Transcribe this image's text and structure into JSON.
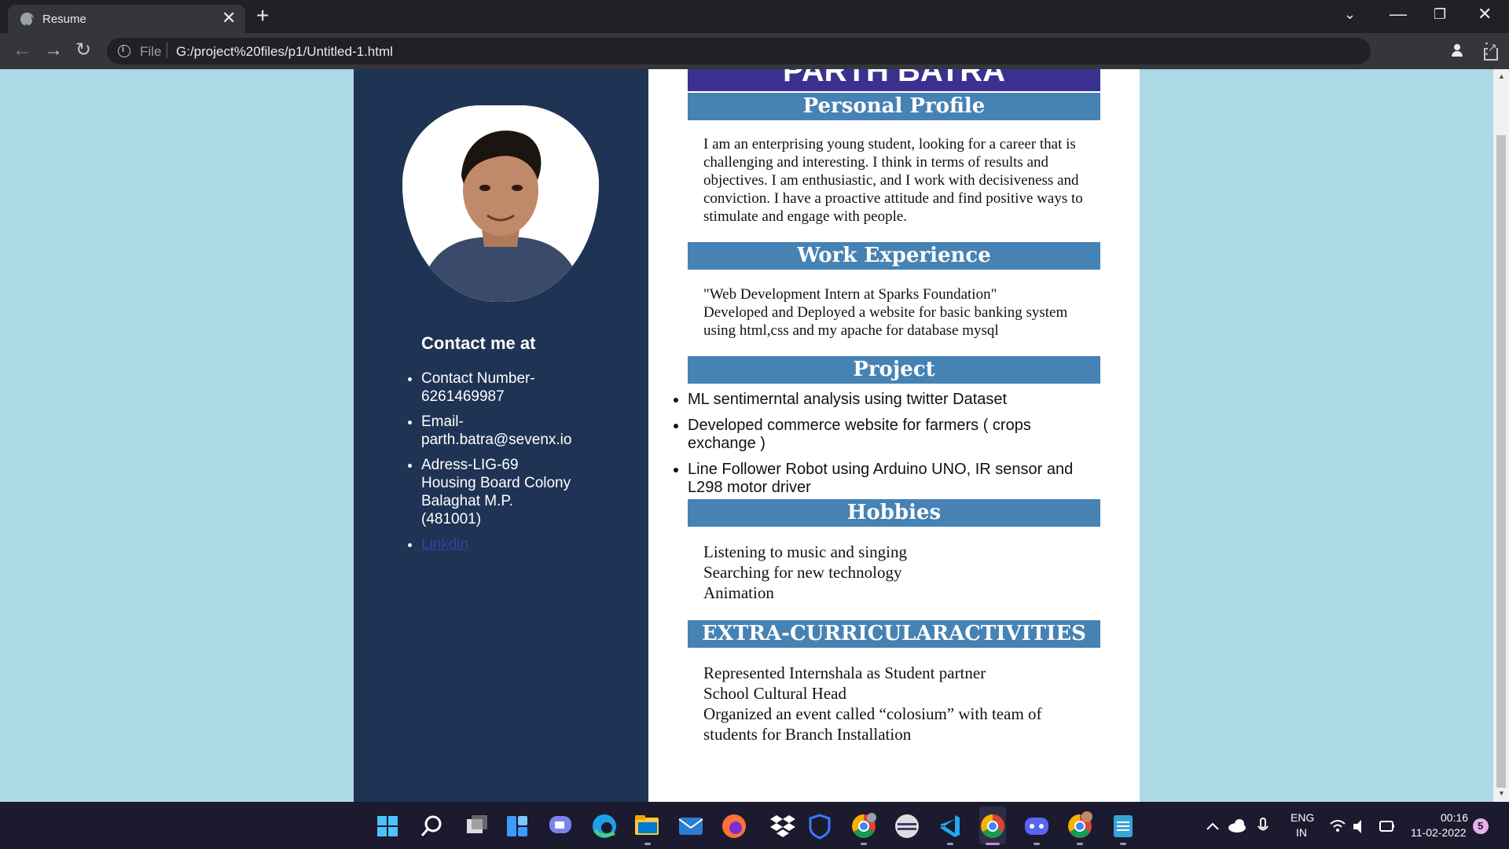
{
  "browser": {
    "tab_title": "Resume",
    "close_glyph": "✕",
    "newtab_glyph": "+",
    "url_scheme_label": "File",
    "url": "G:/project%20files/p1/Untitled-1.html",
    "icons": [
      "back-icon",
      "forward-icon",
      "reload-icon",
      "info-icon",
      "share-icon",
      "star-icon",
      "profile-icon",
      "menu-icon"
    ]
  },
  "resume": {
    "name": "PARTH BATRA",
    "sidebar": {
      "contact_heading": "Contact me at",
      "contacts": [
        "Contact Number-\n6261469987",
        "Email-\nparth.batra@sevenx.io",
        "Adress-LIG-69\nHousing Board Colony\nBalaghat M.P.\n(481001)"
      ],
      "linkedin_label": "Linkdin"
    },
    "sections": {
      "profile_title": "Personal Profile",
      "profile_text": "I am an enterprising young student, looking for a career that is challenging and interesting. I think in terms of results and objectives. I am enthusiastic, and I work with decisiveness and conviction. I have a proactive attitude and find positive ways to stimulate and engage with people.",
      "work_title": "Work Experience",
      "work_lines": [
        "\"Web Development Intern at Sparks Foundation\"",
        "Developed and Deployed a website for basic banking system using html,css and my apache for database mysql"
      ],
      "project_title": "Project",
      "projects": [
        "ML sentimerntal analysis using twitter Dataset",
        "Developed commerce website for farmers ( crops exchange )",
        "Line Follower Robot using Arduino UNO, IR sensor and L298 motor driver"
      ],
      "hobbies_title": "Hobbies",
      "hobbies": [
        "Listening to music and singing",
        "Searching for new technology",
        "Animation"
      ],
      "extra_title": "EXTRA-CURRICULARACTIVITIES",
      "extra": [
        "Represented Internshala as Student partner",
        "School Cultural Head",
        "Organized an event called “colosium” with team of students for Branch Installation"
      ]
    }
  },
  "taskbar": {
    "apps": [
      "windows-start-icon",
      "search-icon",
      "task-view-icon",
      "widgets-icon",
      "teams-chat-icon",
      "edge-icon",
      "file-explorer-icon",
      "mail-icon",
      "firefox-icon",
      "dropbox-icon",
      "security-icon",
      "chrome-profile-icon",
      "terminal-icon",
      "vscode-icon",
      "chrome-icon",
      "discord-icon",
      "chrome-profile-2-icon",
      "notepad-icon"
    ],
    "language_top": "ENG",
    "language_bottom": "IN",
    "time": "00:16",
    "date": "11-02-2022",
    "notification_count": "5"
  },
  "colors": {
    "page_bg": "#add8e6",
    "sidebar_bg": "#1f3354",
    "section_bar": "#4682b4",
    "name_banner": "#3b3190"
  }
}
